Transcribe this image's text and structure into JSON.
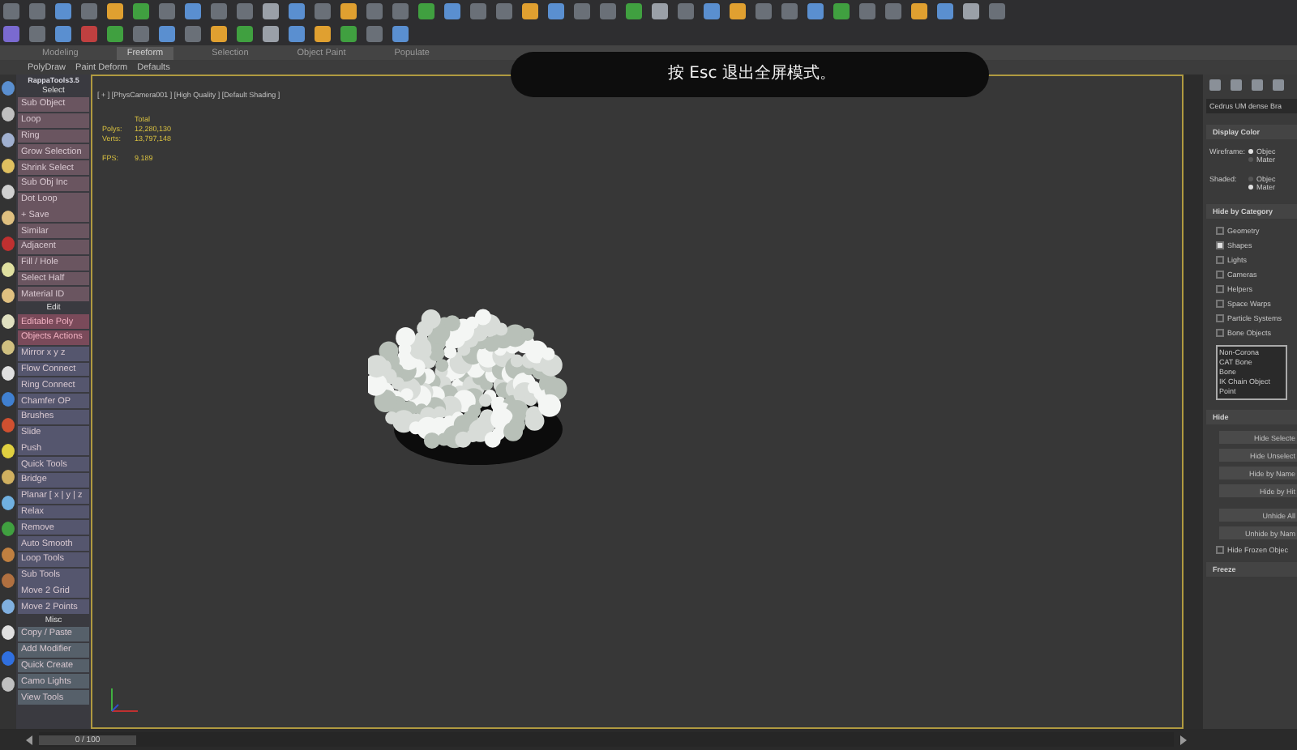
{
  "ribbon": {
    "tabs": [
      {
        "label": "Modeling",
        "selected": false
      },
      {
        "label": "Freeform",
        "selected": true
      },
      {
        "label": "Selection",
        "selected": false
      },
      {
        "label": "Object Paint",
        "selected": false
      },
      {
        "label": "Populate",
        "selected": false
      }
    ],
    "subtabs": [
      "PolyDraw",
      "Paint Deform",
      "Defaults"
    ]
  },
  "notice": "按 Esc 退出全屏模式。",
  "left_panel": {
    "title": "RappaTools3.5",
    "groups": [
      {
        "header": "Select",
        "color": "#6a5560",
        "items": [
          {
            "label": "Sub Object",
            "kind": "button"
          },
          {
            "label": "Loop",
            "kind": "button"
          },
          {
            "label": "Ring",
            "kind": "button"
          },
          {
            "label": "Grow Selection",
            "kind": "button"
          },
          {
            "label": "Shrink Select",
            "kind": "button"
          },
          {
            "label": "Sub Obj Inc",
            "kind": "button"
          },
          {
            "label": "Dot Loop",
            "kind": "button"
          },
          {
            "label": "+ Save",
            "kind": "button"
          },
          {
            "label": "Similar",
            "kind": "button"
          },
          {
            "label": "Adjacent",
            "kind": "button"
          },
          {
            "label": "Fill / Hole",
            "kind": "button"
          },
          {
            "label": "Select Half",
            "kind": "button"
          },
          {
            "label": "Material ID",
            "kind": "button"
          }
        ]
      },
      {
        "header": "Edit",
        "color": "#55566e",
        "items": [
          {
            "label": "Editable Poly",
            "kind": "accent"
          },
          {
            "label": "Objects Actions",
            "kind": "accent"
          },
          {
            "label": "Mirror  x  y  z",
            "kind": "button"
          },
          {
            "label": "Flow Connect",
            "kind": "button"
          },
          {
            "label": "Ring Connect",
            "kind": "button"
          },
          {
            "label": "Chamfer OP",
            "kind": "button"
          },
          {
            "label": "Brushes",
            "kind": "button"
          },
          {
            "label": "Slide",
            "kind": "button"
          },
          {
            "label": "Push",
            "kind": "button"
          },
          {
            "label": "Quick Tools",
            "kind": "button"
          },
          {
            "label": "Bridge",
            "kind": "button"
          },
          {
            "label": "Planar [ x | y | z",
            "kind": "button"
          },
          {
            "label": "Relax",
            "kind": "button"
          },
          {
            "label": "Remove",
            "kind": "button"
          },
          {
            "label": "Auto Smooth",
            "kind": "button"
          },
          {
            "label": "Loop Tools",
            "kind": "button"
          },
          {
            "label": "Sub Tools",
            "kind": "button"
          },
          {
            "label": "Move 2 Grid",
            "kind": "button"
          },
          {
            "label": "Move 2 Points",
            "kind": "button"
          }
        ]
      },
      {
        "header": "Misc",
        "color": "#56606a",
        "items": [
          {
            "label": "Copy / Paste",
            "kind": "button"
          },
          {
            "label": "Add Modifier",
            "kind": "button"
          },
          {
            "label": "Quick Create",
            "kind": "button"
          },
          {
            "label": "Camo Lights",
            "kind": "button"
          },
          {
            "label": "View Tools",
            "kind": "button"
          }
        ]
      }
    ]
  },
  "viewport": {
    "label": "[ + ] [PhysCamera001 ] [High Quality ] [Default Shading ]",
    "total_label": "Total",
    "stats": [
      {
        "label": "Polys:",
        "value": "12,280,130"
      },
      {
        "label": "Verts:",
        "value": "13,797,148"
      }
    ],
    "fps_label": "FPS:",
    "fps_value": "9.189"
  },
  "right_panel": {
    "name_field": "Cedrus UM dense Bra",
    "display_color": {
      "title": "Display Color",
      "rows": [
        {
          "label": "Wireframe:",
          "options": [
            {
              "label": "Objec",
              "selected": true
            },
            {
              "label": "Mater",
              "selected": false
            }
          ]
        },
        {
          "label": "Shaded:",
          "options": [
            {
              "label": "Objec",
              "selected": false
            },
            {
              "label": "Mater",
              "selected": true
            }
          ]
        }
      ]
    },
    "hide_by_category": {
      "title": "Hide by Category",
      "items": [
        {
          "label": "Geometry",
          "checked": false
        },
        {
          "label": "Shapes",
          "checked": true
        },
        {
          "label": "Lights",
          "checked": false
        },
        {
          "label": "Cameras",
          "checked": false
        },
        {
          "label": "Helpers",
          "checked": false
        },
        {
          "label": "Space Warps",
          "checked": false
        },
        {
          "label": "Particle Systems",
          "checked": false
        },
        {
          "label": "Bone Objects",
          "checked": false
        }
      ],
      "list": [
        "Non-Corona",
        "CAT Bone",
        "Bone",
        "IK Chain Object",
        "Point"
      ]
    },
    "hide": {
      "title": "Hide",
      "buttons": [
        "Hide Selecte",
        "Hide Unselect",
        "Hide by Name",
        "Hide by Hit",
        "Unhide All",
        "Unhide by Nam"
      ],
      "checkbox": {
        "label": "Hide Frozen Objec",
        "checked": false
      }
    },
    "freeze": {
      "title": "Freeze"
    }
  },
  "timeline": {
    "frame": "0 / 100",
    "level": 0
  }
}
